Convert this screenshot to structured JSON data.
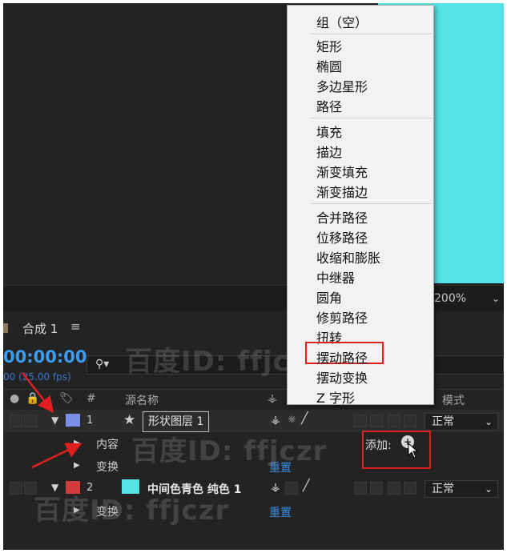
{
  "viewer": {
    "zoom": "200%"
  },
  "timeline": {
    "tab_title": "合成 1",
    "tab_menu": "≡",
    "timecode": "00:00:00",
    "fps": "00 (25.00 fps)",
    "columns": {
      "hash": "#",
      "source_name": "源名称",
      "mode": "模式"
    },
    "layers": [
      {
        "number": "1",
        "name": "形状图层 1",
        "label_color": "#7c8fe8",
        "mode": "正常",
        "children": [
          {
            "label": "内容",
            "add_label": "添加:",
            "add_button": "+"
          },
          {
            "label": "变换",
            "action": "重置"
          }
        ]
      },
      {
        "number": "2",
        "name": "中间色青色 纯色 1",
        "label_color": "#d23b3b",
        "thumb_color": "#55e4e6",
        "mode": "正常",
        "children": [
          {
            "label": "变换",
            "action": "重置"
          }
        ]
      }
    ]
  },
  "context_menu": {
    "items": [
      "组（空）",
      "矩形",
      "椭圆",
      "多边星形",
      "路径",
      "填充",
      "描边",
      "渐变填充",
      "渐变描边",
      "合并路径",
      "位移路径",
      "收缩和膨胀",
      "中继器",
      "圆角",
      "修剪路径",
      "扭转",
      "摆动路径",
      "摆动变换",
      "Z 字形"
    ],
    "highlighted": "摆动路径"
  },
  "watermarks": [
    "百度ID: ffjczr",
    "百度ID: ffjczr",
    "百度ID: ffjczr"
  ],
  "colors": {
    "accent": "#3b9cf0",
    "annotation": "#e02020",
    "composition_bg": "#55e4e6"
  }
}
